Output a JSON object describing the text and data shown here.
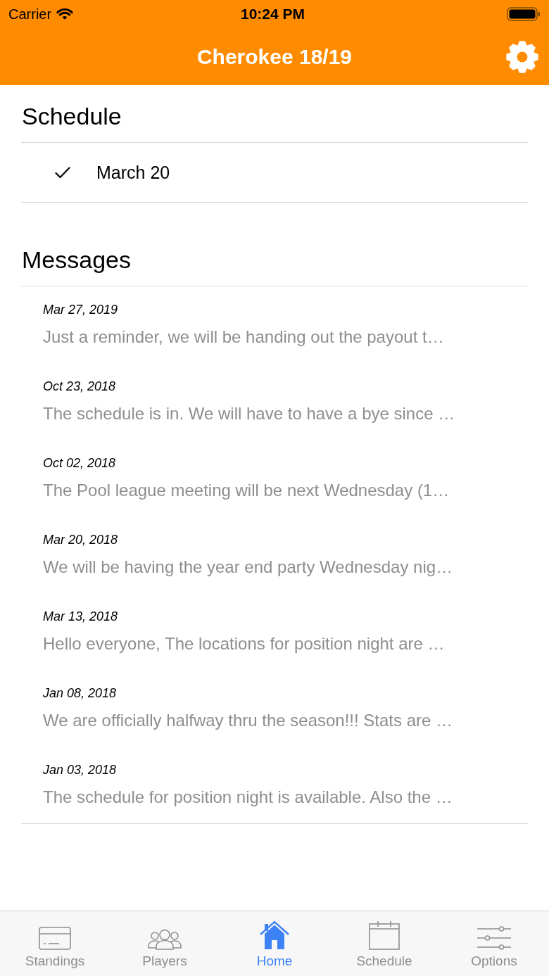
{
  "status_bar": {
    "carrier": "Carrier",
    "time": "10:24 PM"
  },
  "nav_bar": {
    "title": "Cherokee 18/19"
  },
  "schedule": {
    "heading": "Schedule",
    "items": [
      {
        "label": "March 20",
        "checked": true
      }
    ]
  },
  "messages": {
    "heading": "Messages",
    "items": [
      {
        "date": "Mar 27, 2019",
        "preview": "Just a reminder, we will be handing out the payout t…"
      },
      {
        "date": "Oct 23, 2018",
        "preview": "The schedule is in. We will have to have a bye since …"
      },
      {
        "date": "Oct 02, 2018",
        "preview": "The Pool league meeting will be next Wednesday (1…"
      },
      {
        "date": "Mar 20, 2018",
        "preview": "We will be having the year end party Wednesday nig…"
      },
      {
        "date": "Mar 13, 2018",
        "preview": "Hello everyone, The locations for position night are …"
      },
      {
        "date": "Jan 08, 2018",
        "preview": "We are officially halfway thru the season!!! Stats are …"
      },
      {
        "date": "Jan 03, 2018",
        "preview": "The schedule for position night is available. Also the …"
      }
    ]
  },
  "tab_bar": {
    "tabs": [
      {
        "kind": "standings",
        "label": "Standings",
        "selected": false
      },
      {
        "kind": "players",
        "label": "Players",
        "selected": false
      },
      {
        "kind": "home",
        "label": "Home",
        "selected": true
      },
      {
        "kind": "schedule",
        "label": "Schedule",
        "selected": false
      },
      {
        "kind": "options",
        "label": "Options",
        "selected": false
      }
    ]
  }
}
